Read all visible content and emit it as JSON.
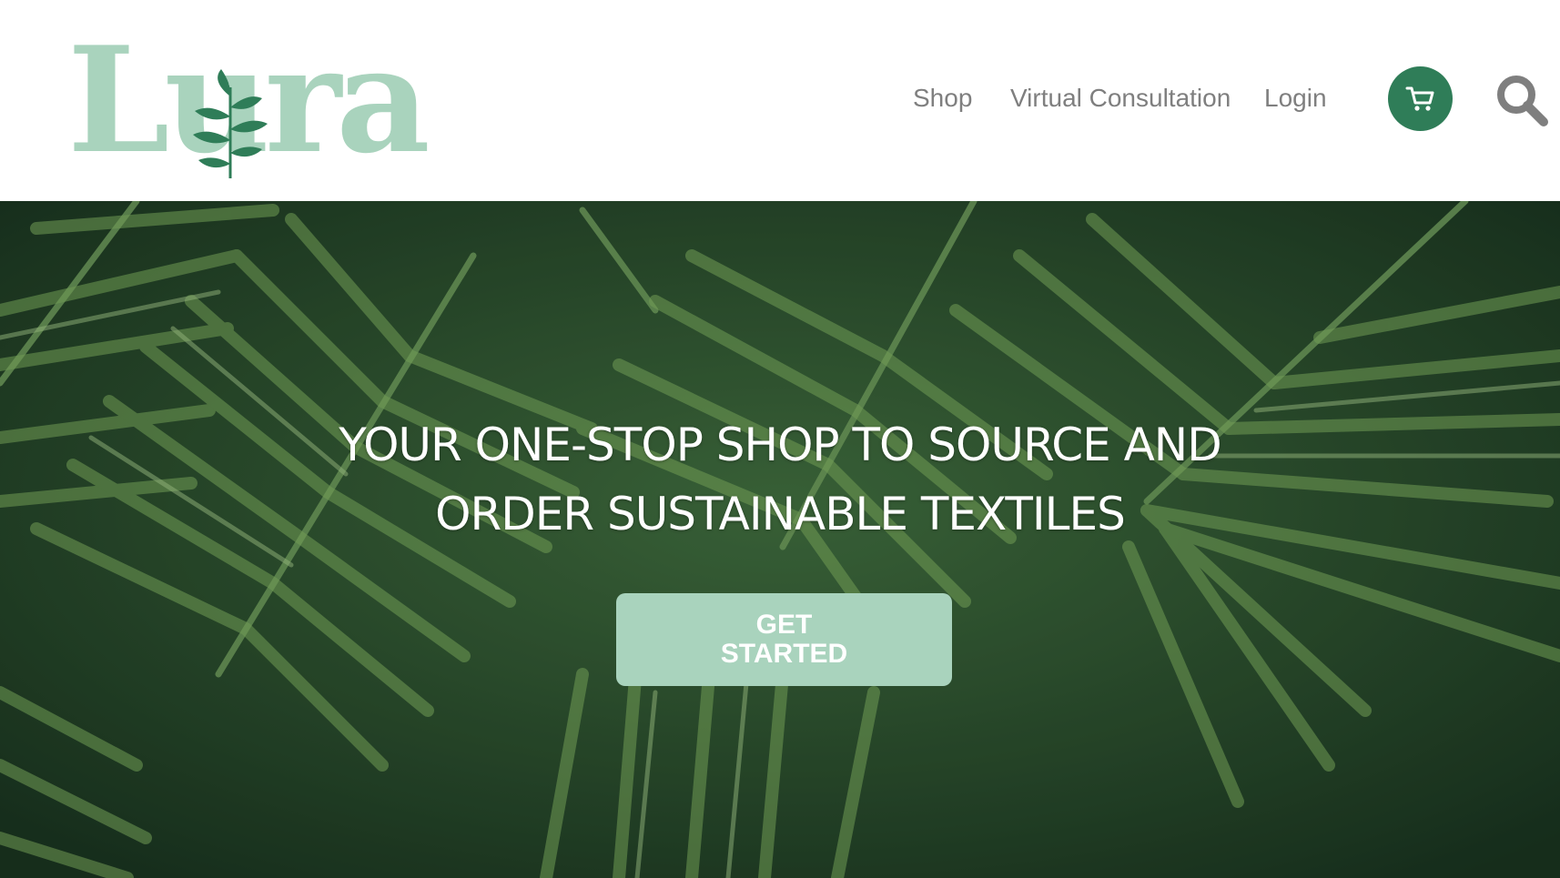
{
  "brand": {
    "name": "Lura",
    "color": "#a9d3bd"
  },
  "nav": {
    "items": [
      {
        "label": "Shop"
      },
      {
        "label": "Virtual Consultation"
      },
      {
        "label": "Login"
      }
    ],
    "cart_icon": "shopping-cart-icon",
    "search_icon": "search-icon"
  },
  "hero": {
    "title_line1": "YOUR ONE-STOP SHOP TO SOURCE AND",
    "title_line2": "ORDER SUSTAINABLE TEXTILES",
    "cta_line1": "GET",
    "cta_line2": "STARTED",
    "background": "palm-leaves-photo"
  },
  "colors": {
    "accent": "#2f7d58",
    "cta": "#a9d3bd",
    "nav_text": "#7f7f7f"
  }
}
